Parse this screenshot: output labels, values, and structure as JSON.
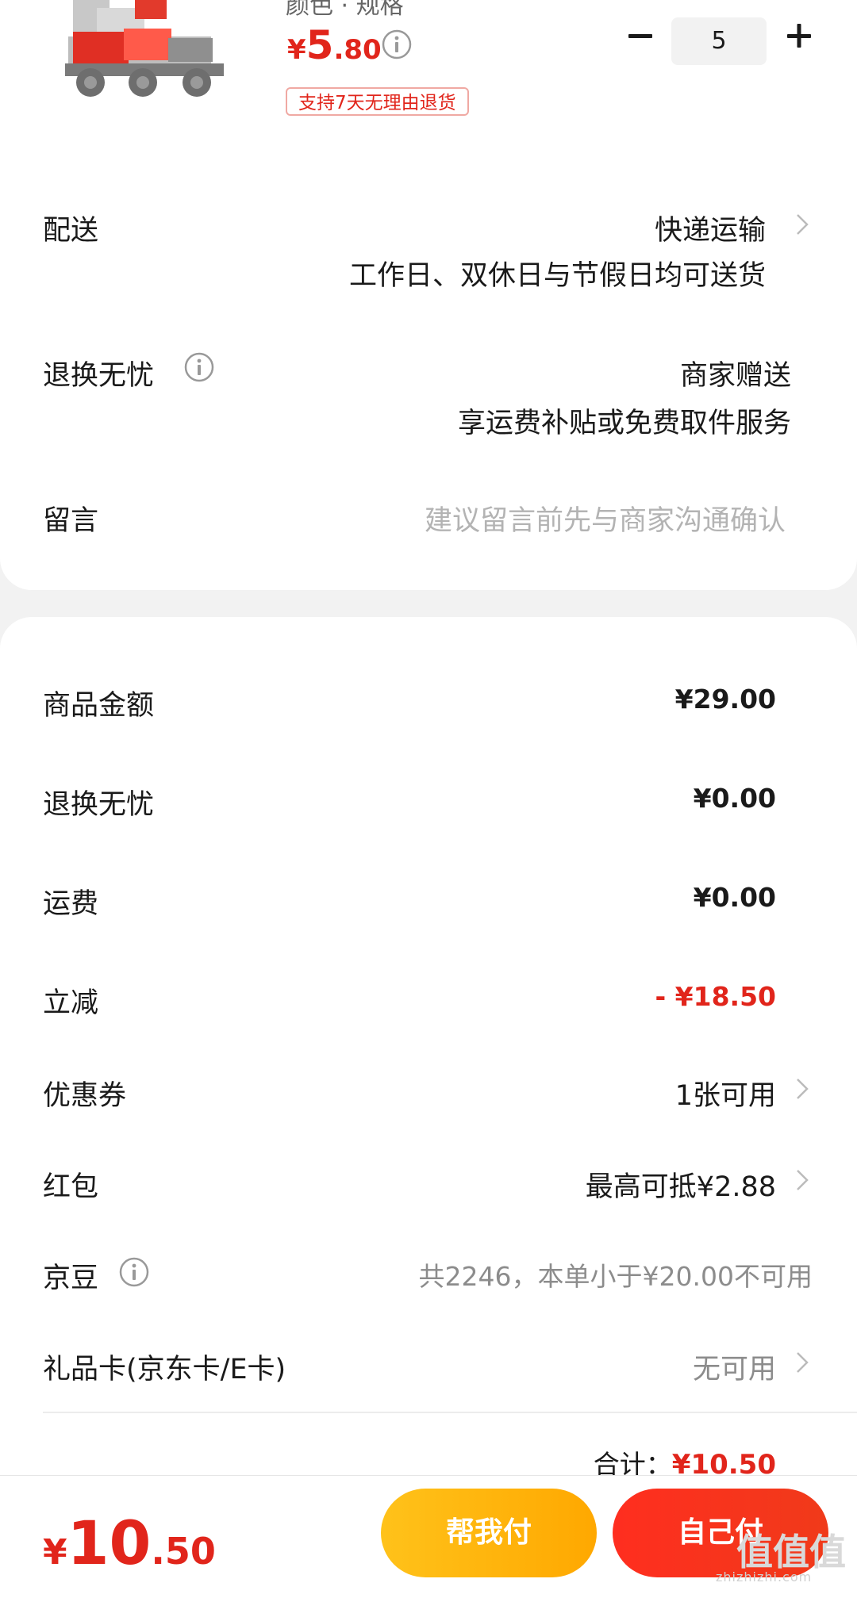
{
  "product": {
    "top_text": "颜色 · 规格",
    "price_yen": "¥",
    "price_int": "5",
    "price_dec": ".80",
    "return_badge": "支持7天无理由退货",
    "quantity": "5"
  },
  "delivery": {
    "label": "配送",
    "method": "快递运输",
    "detail": "工作日、双休日与节假日均可送货"
  },
  "return_service": {
    "label": "退换无忧",
    "value": "商家赠送",
    "detail": "享运费补贴或免费取件服务"
  },
  "message": {
    "label": "留言",
    "placeholder": "建议留言前先与商家沟通确认"
  },
  "summary": {
    "goods_label": "商品金额",
    "goods_value": "¥29.00",
    "return_label": "退换无忧",
    "return_value": "¥0.00",
    "shipping_label": "运费",
    "shipping_value": "¥0.00",
    "discount_label": "立减",
    "discount_value": "- ¥18.50",
    "coupon_label": "优惠券",
    "coupon_value": "1张可用",
    "redpacket_label": "红包",
    "redpacket_value": "最高可抵¥2.88",
    "jingdou_label": "京豆",
    "jingdou_value": "共2246，本单小于¥20.00不可用",
    "giftcard_label": "礼品卡(京东卡/E卡)",
    "giftcard_value": "无可用",
    "total_label": "合计：",
    "total_value": "¥10.50"
  },
  "bottom": {
    "price_yen": "¥",
    "price_int": "10",
    "price_dec": ".50",
    "help_pay": "帮我付",
    "self_pay": "自己付",
    "watermark": "值值值",
    "watermark_url": "zhizhizhi.com"
  },
  "colors": {
    "accent_red": "#e1251b",
    "help_button": "#ffb300",
    "self_button": "#f5311d"
  },
  "icons": [
    "info-icon",
    "minus-icon",
    "plus-icon",
    "chevron-right-icon"
  ]
}
